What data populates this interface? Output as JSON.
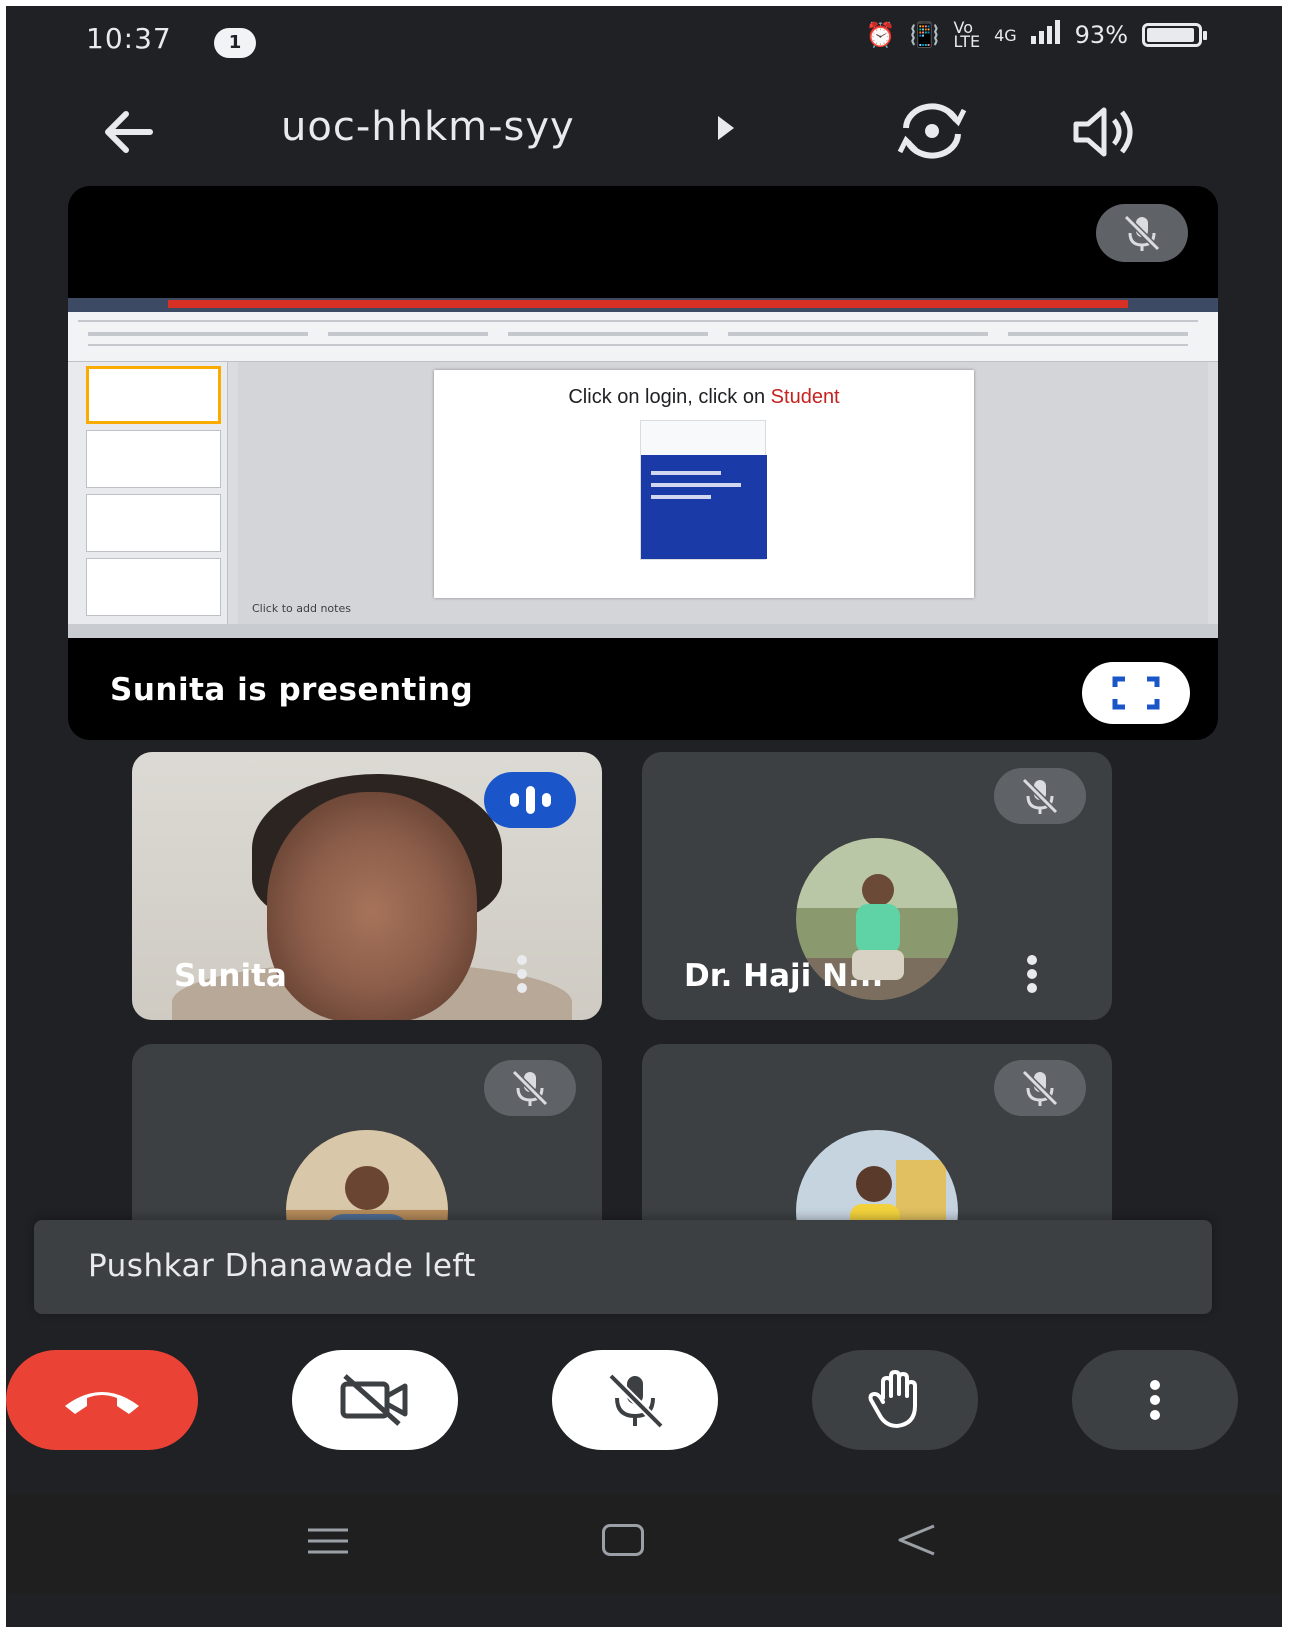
{
  "status_bar": {
    "time": "10:37",
    "notification_count": "1",
    "network": "4G",
    "battery": "93%",
    "battery_level": 0.93
  },
  "header": {
    "meeting_code": "uoc-hhkm-syy"
  },
  "presentation": {
    "presenting_text": "Sunita is presenting",
    "slide_title_prefix": "Click on login, click on ",
    "slide_title_accent": "Student",
    "notes_placeholder": "Click to add notes"
  },
  "participants": [
    {
      "name": "Sunita",
      "speaking": true
    },
    {
      "name": "Dr. Haji N...",
      "muted": true
    },
    {
      "name": "",
      "muted": true
    },
    {
      "name": "",
      "muted": true
    }
  ],
  "toast": {
    "message": "Pushkar Dhanawade left"
  },
  "icons": {
    "back": "arrow-left-icon",
    "switch_camera": "switch-camera-icon",
    "speaker": "speaker-icon",
    "mic_off": "mic-off-icon",
    "fullscreen": "fullscreen-icon",
    "speaking": "speaking-indicator-icon",
    "more": "more-vertical-icon",
    "end_call": "phone-hangup-icon",
    "camera_off": "video-off-icon",
    "raise_hand": "hand-icon"
  },
  "colors": {
    "background": "#202124",
    "end_call": "#ea4335",
    "speaking_badge": "#1a56c9",
    "muted_badge": "#5f6368",
    "slide_accent": "#c5221f"
  }
}
